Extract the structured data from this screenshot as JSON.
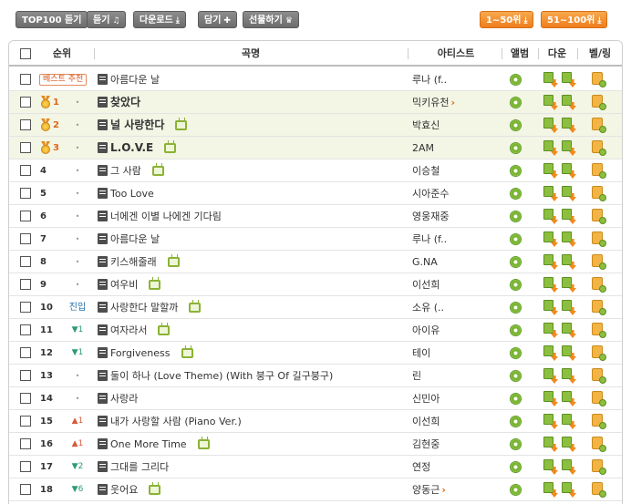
{
  "toolbar": {
    "top100_play": "TOP100 듣기",
    "play": "듣기",
    "download": "다운로드",
    "add": "담기",
    "gift": "선물하기",
    "range1": "1~50위",
    "range2": "51~100위"
  },
  "header": {
    "rank": "순위",
    "title": "곡명",
    "artist": "아티스트",
    "album": "앨범",
    "download": "다운",
    "bell_ring": "벨/링"
  },
  "best": {
    "badge": "베스트 추천",
    "title": "아름다운 날",
    "artist": "루나 (f.."
  },
  "rows": [
    {
      "rank": "1",
      "change": "•",
      "change_type": "same",
      "title": "찾았다",
      "artist": "믹키유천",
      "artist_more": "›",
      "mv": false,
      "bold": true,
      "highlight": true,
      "medal": true
    },
    {
      "rank": "2",
      "change": "•",
      "change_type": "same",
      "title": "널 사랑한다",
      "artist": "박효신",
      "mv": true,
      "bold": true,
      "highlight": true,
      "medal": true
    },
    {
      "rank": "3",
      "change": "•",
      "change_type": "same",
      "title": "L.O.V.E",
      "artist": "2AM",
      "mv": true,
      "bold": true,
      "highlight": true,
      "medal": true
    },
    {
      "rank": "4",
      "change": "•",
      "change_type": "same",
      "title": "그 사람",
      "artist": "이승철",
      "mv": true
    },
    {
      "rank": "5",
      "change": "•",
      "change_type": "same",
      "title": "Too Love",
      "artist": "시아준수",
      "mv": false
    },
    {
      "rank": "6",
      "change": "•",
      "change_type": "same",
      "title": "너에겐 이별 나에겐 기다림",
      "artist": "영웅재중",
      "mv": false
    },
    {
      "rank": "7",
      "change": "•",
      "change_type": "same",
      "title": "아름다운 날",
      "artist": "루나 (f..",
      "mv": false
    },
    {
      "rank": "8",
      "change": "•",
      "change_type": "same",
      "title": "키스해줄래",
      "artist": "G.NA",
      "mv": true
    },
    {
      "rank": "9",
      "change": "•",
      "change_type": "same",
      "title": "여우비",
      "artist": "이선희",
      "mv": true
    },
    {
      "rank": "10",
      "change": "진입",
      "change_type": "new",
      "title": "사랑한다 말할까",
      "artist": "소유 (..",
      "mv": true
    },
    {
      "rank": "11",
      "change": "▼1",
      "change_type": "up",
      "title": "여자라서",
      "artist": "아이유",
      "mv": true
    },
    {
      "rank": "12",
      "change": "▼1",
      "change_type": "up",
      "title": "Forgiveness",
      "artist": "테이",
      "mv": true
    },
    {
      "rank": "13",
      "change": "•",
      "change_type": "same",
      "title": "둘이 하나 (Love Theme) (With 붕구 Of 길구붕구)",
      "artist": "린",
      "mv": false
    },
    {
      "rank": "14",
      "change": "•",
      "change_type": "same",
      "title": "사랑라",
      "artist": "신민아",
      "mv": false
    },
    {
      "rank": "15",
      "change": "▲1",
      "change_type": "dn",
      "title": "내가 사랑할 사람 (Piano Ver.)",
      "artist": "이선희",
      "mv": false
    },
    {
      "rank": "16",
      "change": "▲1",
      "change_type": "dn",
      "title": "One More Time",
      "artist": "김현중",
      "mv": true
    },
    {
      "rank": "17",
      "change": "▼2",
      "change_type": "up",
      "title": "그대를 그리다",
      "artist": "연정",
      "mv": false
    },
    {
      "rank": "18",
      "change": "▼6",
      "change_type": "up",
      "title": "웃어요",
      "artist": "양동근",
      "artist_more": "›",
      "mv": true
    }
  ]
}
